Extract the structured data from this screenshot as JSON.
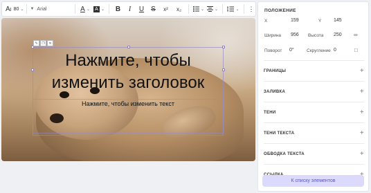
{
  "toolbar": {
    "font_size": "80",
    "font_name": "Arial",
    "superscript_label": "x²",
    "subscript_label": "x₂"
  },
  "canvas": {
    "title_line1": "Нажмите, чтобы",
    "title_line2": "изменить заголовок",
    "subtitle": "Нажмите, чтобы изменить текст"
  },
  "panel": {
    "position_header": "ПОЛОЖЕНИЕ",
    "x_label": "X",
    "x_value": "159",
    "y_label": "Y",
    "y_value": "145",
    "width_label": "Ширина",
    "width_value": "956",
    "height_label": "Высота",
    "height_value": "250",
    "rotation_label": "Поворот",
    "rotation_value": "0°",
    "rounding_label": "Скругление",
    "rounding_value": "0",
    "sections": [
      {
        "label": "ГРАНИЦЫ"
      },
      {
        "label": "ЗАЛИВКА"
      },
      {
        "label": "ТЕНИ"
      },
      {
        "label": "ТЕНИ ТЕКСТА"
      },
      {
        "label": "ОБВОДКА ТЕКСТА"
      },
      {
        "label": "ССЫЛКА"
      }
    ],
    "list_button": "К списку элементов"
  }
}
